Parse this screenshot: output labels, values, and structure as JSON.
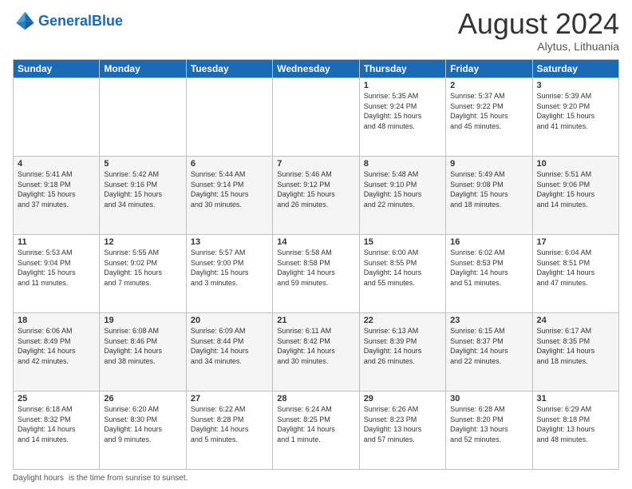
{
  "header": {
    "logo_general": "General",
    "logo_blue": "Blue",
    "month_title": "August 2024",
    "location": "Alytus, Lithuania"
  },
  "days_of_week": [
    "Sunday",
    "Monday",
    "Tuesday",
    "Wednesday",
    "Thursday",
    "Friday",
    "Saturday"
  ],
  "footer": {
    "daylight_label": "Daylight hours"
  },
  "weeks": [
    {
      "row_bg": "#fff",
      "days": [
        {
          "num": "",
          "info": ""
        },
        {
          "num": "",
          "info": ""
        },
        {
          "num": "",
          "info": ""
        },
        {
          "num": "",
          "info": ""
        },
        {
          "num": "1",
          "info": "Sunrise: 5:35 AM\nSunset: 9:24 PM\nDaylight: 15 hours\nand 48 minutes."
        },
        {
          "num": "2",
          "info": "Sunrise: 5:37 AM\nSunset: 9:22 PM\nDaylight: 15 hours\nand 45 minutes."
        },
        {
          "num": "3",
          "info": "Sunrise: 5:39 AM\nSunset: 9:20 PM\nDaylight: 15 hours\nand 41 minutes."
        }
      ]
    },
    {
      "row_bg": "#f5f5f5",
      "days": [
        {
          "num": "4",
          "info": "Sunrise: 5:41 AM\nSunset: 9:18 PM\nDaylight: 15 hours\nand 37 minutes."
        },
        {
          "num": "5",
          "info": "Sunrise: 5:42 AM\nSunset: 9:16 PM\nDaylight: 15 hours\nand 34 minutes."
        },
        {
          "num": "6",
          "info": "Sunrise: 5:44 AM\nSunset: 9:14 PM\nDaylight: 15 hours\nand 30 minutes."
        },
        {
          "num": "7",
          "info": "Sunrise: 5:46 AM\nSunset: 9:12 PM\nDaylight: 15 hours\nand 26 minutes."
        },
        {
          "num": "8",
          "info": "Sunrise: 5:48 AM\nSunset: 9:10 PM\nDaylight: 15 hours\nand 22 minutes."
        },
        {
          "num": "9",
          "info": "Sunrise: 5:49 AM\nSunset: 9:08 PM\nDaylight: 15 hours\nand 18 minutes."
        },
        {
          "num": "10",
          "info": "Sunrise: 5:51 AM\nSunset: 9:06 PM\nDaylight: 15 hours\nand 14 minutes."
        }
      ]
    },
    {
      "row_bg": "#fff",
      "days": [
        {
          "num": "11",
          "info": "Sunrise: 5:53 AM\nSunset: 9:04 PM\nDaylight: 15 hours\nand 11 minutes."
        },
        {
          "num": "12",
          "info": "Sunrise: 5:55 AM\nSunset: 9:02 PM\nDaylight: 15 hours\nand 7 minutes."
        },
        {
          "num": "13",
          "info": "Sunrise: 5:57 AM\nSunset: 9:00 PM\nDaylight: 15 hours\nand 3 minutes."
        },
        {
          "num": "14",
          "info": "Sunrise: 5:58 AM\nSunset: 8:58 PM\nDaylight: 14 hours\nand 59 minutes."
        },
        {
          "num": "15",
          "info": "Sunrise: 6:00 AM\nSunset: 8:55 PM\nDaylight: 14 hours\nand 55 minutes."
        },
        {
          "num": "16",
          "info": "Sunrise: 6:02 AM\nSunset: 8:53 PM\nDaylight: 14 hours\nand 51 minutes."
        },
        {
          "num": "17",
          "info": "Sunrise: 6:04 AM\nSunset: 8:51 PM\nDaylight: 14 hours\nand 47 minutes."
        }
      ]
    },
    {
      "row_bg": "#f5f5f5",
      "days": [
        {
          "num": "18",
          "info": "Sunrise: 6:06 AM\nSunset: 8:49 PM\nDaylight: 14 hours\nand 42 minutes."
        },
        {
          "num": "19",
          "info": "Sunrise: 6:08 AM\nSunset: 8:46 PM\nDaylight: 14 hours\nand 38 minutes."
        },
        {
          "num": "20",
          "info": "Sunrise: 6:09 AM\nSunset: 8:44 PM\nDaylight: 14 hours\nand 34 minutes."
        },
        {
          "num": "21",
          "info": "Sunrise: 6:11 AM\nSunset: 8:42 PM\nDaylight: 14 hours\nand 30 minutes."
        },
        {
          "num": "22",
          "info": "Sunrise: 6:13 AM\nSunset: 8:39 PM\nDaylight: 14 hours\nand 26 minutes."
        },
        {
          "num": "23",
          "info": "Sunrise: 6:15 AM\nSunset: 8:37 PM\nDaylight: 14 hours\nand 22 minutes."
        },
        {
          "num": "24",
          "info": "Sunrise: 6:17 AM\nSunset: 8:35 PM\nDaylight: 14 hours\nand 18 minutes."
        }
      ]
    },
    {
      "row_bg": "#fff",
      "days": [
        {
          "num": "25",
          "info": "Sunrise: 6:18 AM\nSunset: 8:32 PM\nDaylight: 14 hours\nand 14 minutes."
        },
        {
          "num": "26",
          "info": "Sunrise: 6:20 AM\nSunset: 8:30 PM\nDaylight: 14 hours\nand 9 minutes."
        },
        {
          "num": "27",
          "info": "Sunrise: 6:22 AM\nSunset: 8:28 PM\nDaylight: 14 hours\nand 5 minutes."
        },
        {
          "num": "28",
          "info": "Sunrise: 6:24 AM\nSunset: 8:25 PM\nDaylight: 14 hours\nand 1 minute."
        },
        {
          "num": "29",
          "info": "Sunrise: 6:26 AM\nSunset: 8:23 PM\nDaylight: 13 hours\nand 57 minutes."
        },
        {
          "num": "30",
          "info": "Sunrise: 6:28 AM\nSunset: 8:20 PM\nDaylight: 13 hours\nand 52 minutes."
        },
        {
          "num": "31",
          "info": "Sunrise: 6:29 AM\nSunset: 8:18 PM\nDaylight: 13 hours\nand 48 minutes."
        }
      ]
    }
  ]
}
